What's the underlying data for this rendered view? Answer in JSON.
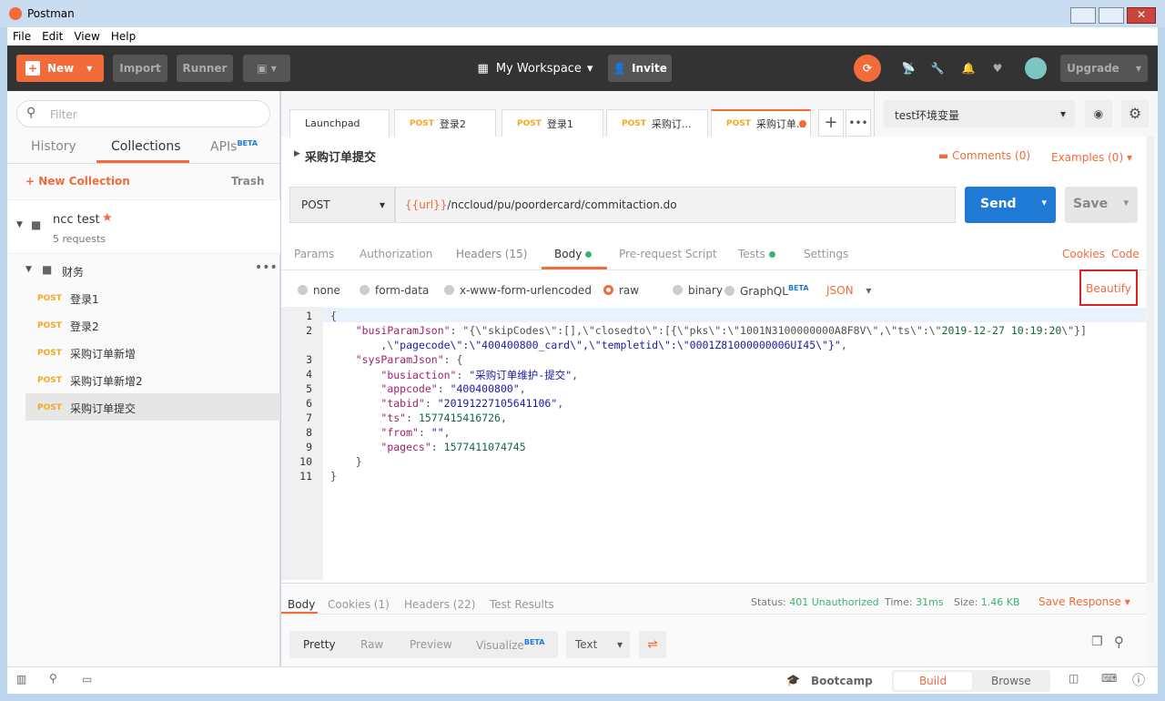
{
  "window": {
    "title": "Postman"
  },
  "menu": [
    "File",
    "Edit",
    "View",
    "Help"
  ],
  "toolbar": {
    "new": "New",
    "import": "Import",
    "runner": "Runner",
    "workspace": "My Workspace",
    "invite": "Invite",
    "upgrade": "Upgrade"
  },
  "sidebar": {
    "filter_placeholder": "Filter",
    "tabs": [
      "History",
      "Collections",
      "APIs"
    ],
    "apis_badge": "BETA",
    "new_collection": "New Collection",
    "trash": "Trash",
    "collection": {
      "name": "ncc test",
      "count": "5 requests"
    },
    "folder": "财务",
    "requests": [
      {
        "method": "POST",
        "name": "登录1"
      },
      {
        "method": "POST",
        "name": "登录2"
      },
      {
        "method": "POST",
        "name": "采购订单新增"
      },
      {
        "method": "POST",
        "name": "采购订单新增2"
      },
      {
        "method": "POST",
        "name": "采购订单提交"
      }
    ]
  },
  "tabs": [
    {
      "method": "",
      "name": "Launchpad"
    },
    {
      "method": "POST",
      "name": "登录2"
    },
    {
      "method": "POST",
      "name": "登录1"
    },
    {
      "method": "POST",
      "name": "采购订..."
    },
    {
      "method": "POST",
      "name": "采购订单..."
    }
  ],
  "environment": "test环境变量",
  "request": {
    "name": "采购订单提交",
    "comments": "Comments (0)",
    "examples": "Examples (0)",
    "method": "POST",
    "url_var": "{{url}}",
    "url_path": "/nccloud/pu/poordercard/commitaction.do",
    "send": "Send",
    "save": "Save",
    "subtabs": [
      "Params",
      "Authorization",
      "Headers (15)",
      "Body",
      "Pre-request Script",
      "Tests",
      "Settings"
    ],
    "cookies": "Cookies",
    "code": "Code",
    "body_modes": [
      "none",
      "form-data",
      "x-www-form-urlencoded",
      "raw",
      "binary",
      "GraphQL"
    ],
    "graphql_badge": "BETA",
    "format": "JSON",
    "beautify": "Beautify"
  },
  "code_lines": [
    "{",
    "    \"busiParamJson\": \"{\\\"skipCodes\\\":[],\\\"closedto\\\":[{\\\"pks\\\":\\\"1001N3100000000A8F8V\\\",\\\"ts\\\":\\\"2019-12-27 10:19:20\\\"}]",
    "        ,\\\"pagecode\\\":\\\"400400800_card\\\",\\\"templetid\\\":\\\"0001Z81000000006UI45\\\"}\",",
    "    \"sysParamJson\": {",
    "        \"busiaction\": \"采购订单维护-提交\",",
    "        \"appcode\": \"400400800\",",
    "        \"tabid\": \"20191227105641106\",",
    "        \"ts\": 1577415416726,",
    "        \"from\": \"\",",
    "        \"pagecs\": 1577411074745",
    "    }",
    "}"
  ],
  "line_numbers": [
    "1",
    "2",
    "",
    "3",
    "4",
    "5",
    "6",
    "7",
    "8",
    "9",
    "10",
    "11"
  ],
  "response": {
    "tabs": [
      "Body",
      "Cookies (1)",
      "Headers (22)",
      "Test Results"
    ],
    "status_label": "Status:",
    "status": "401 Unauthorized",
    "time_label": "Time:",
    "time": "31ms",
    "size_label": "Size:",
    "size": "1.46 KB",
    "save": "Save Response",
    "views": [
      "Pretty",
      "Raw",
      "Preview",
      "Visualize"
    ],
    "visualize_badge": "BETA",
    "type": "Text"
  },
  "statusbar": {
    "bootcamp": "Bootcamp",
    "build": "Build",
    "browse": "Browse"
  }
}
